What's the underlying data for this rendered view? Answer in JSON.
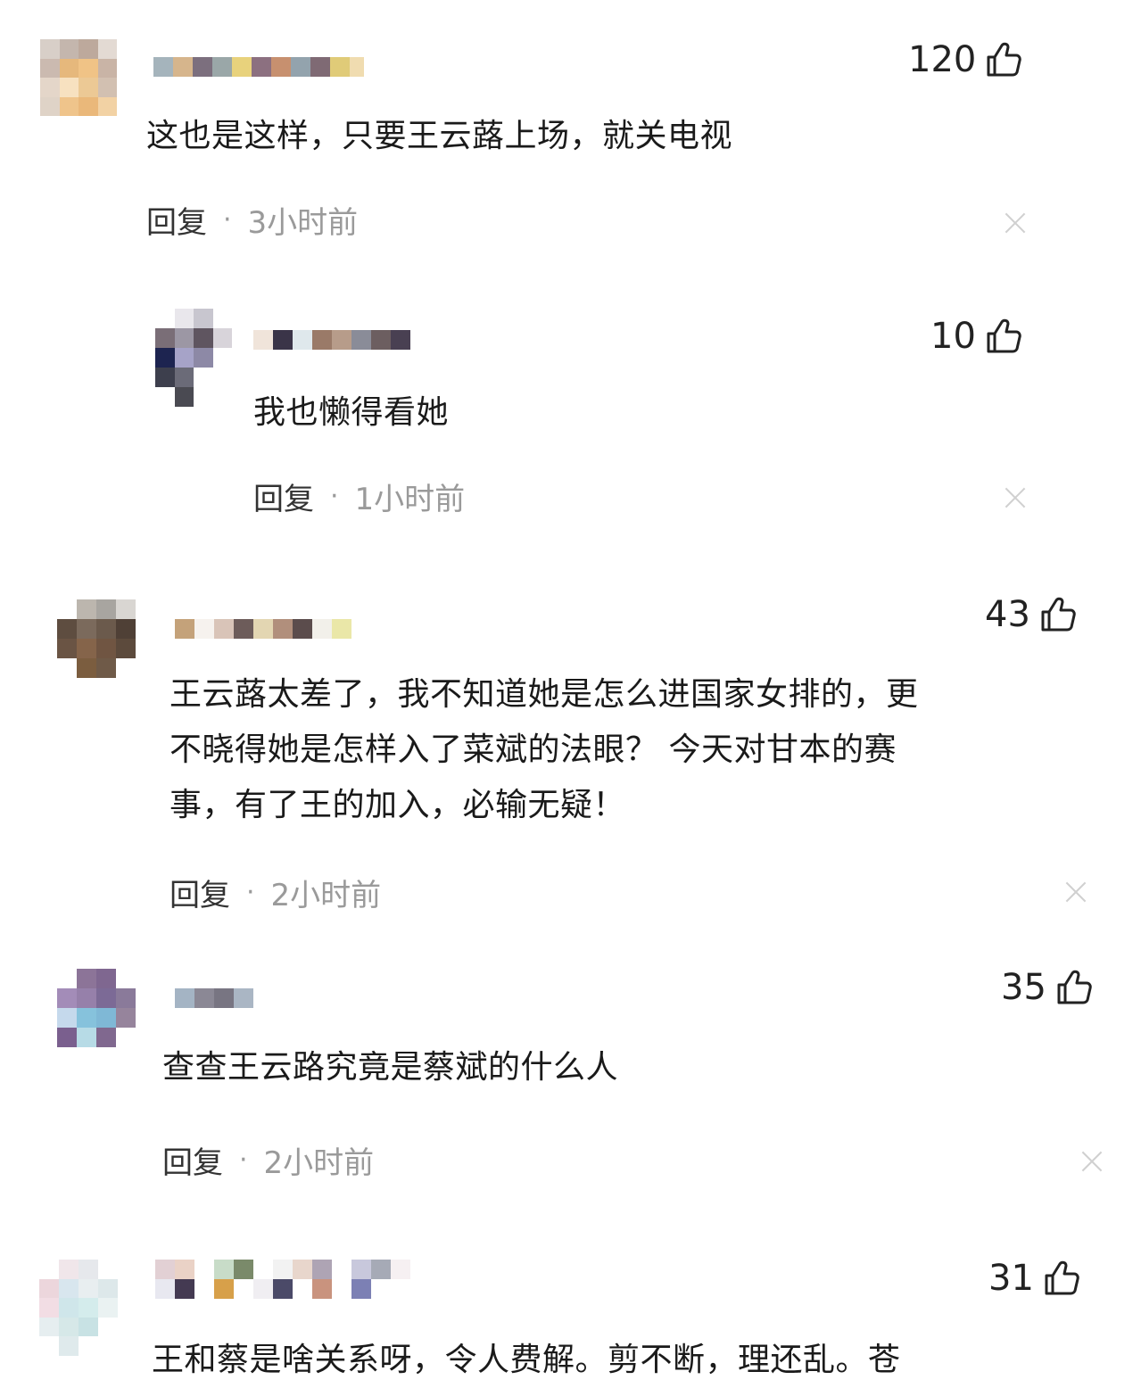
{
  "comments": [
    {
      "likes": "120",
      "text": "这也是这样，只要王云蕗上场，就关电视",
      "reply_label": "回复",
      "separator": "·",
      "time": "3小时前"
    },
    {
      "likes": "10",
      "text": "我也懒得看她",
      "reply_label": "回复",
      "separator": "·",
      "time": "1小时前"
    },
    {
      "likes": "43",
      "text_lines": [
        "王云蕗太差了，我不知道她是怎么进国家女排的，更",
        "不晓得她是怎样入了菜斌的法眼？ 今天对甘本的赛",
        "事，有了王的加入，必输无疑！"
      ],
      "reply_label": "回复",
      "separator": "·",
      "time": "2小时前"
    },
    {
      "likes": "35",
      "text": "查查王云路究竟是蔡斌的什么人",
      "reply_label": "回复",
      "separator": "·",
      "time": "2小时前"
    },
    {
      "likes": "31",
      "text": "王和蔡是啥关系呀，令人费解。剪不断，理还乱。苍"
    }
  ],
  "icons": {
    "like": "thumbs-up-icon",
    "close": "close-icon"
  },
  "colors": {
    "text": "#1a1a1a",
    "meta_gray": "#9a9a9a",
    "close_gray": "#d0d0d0"
  }
}
